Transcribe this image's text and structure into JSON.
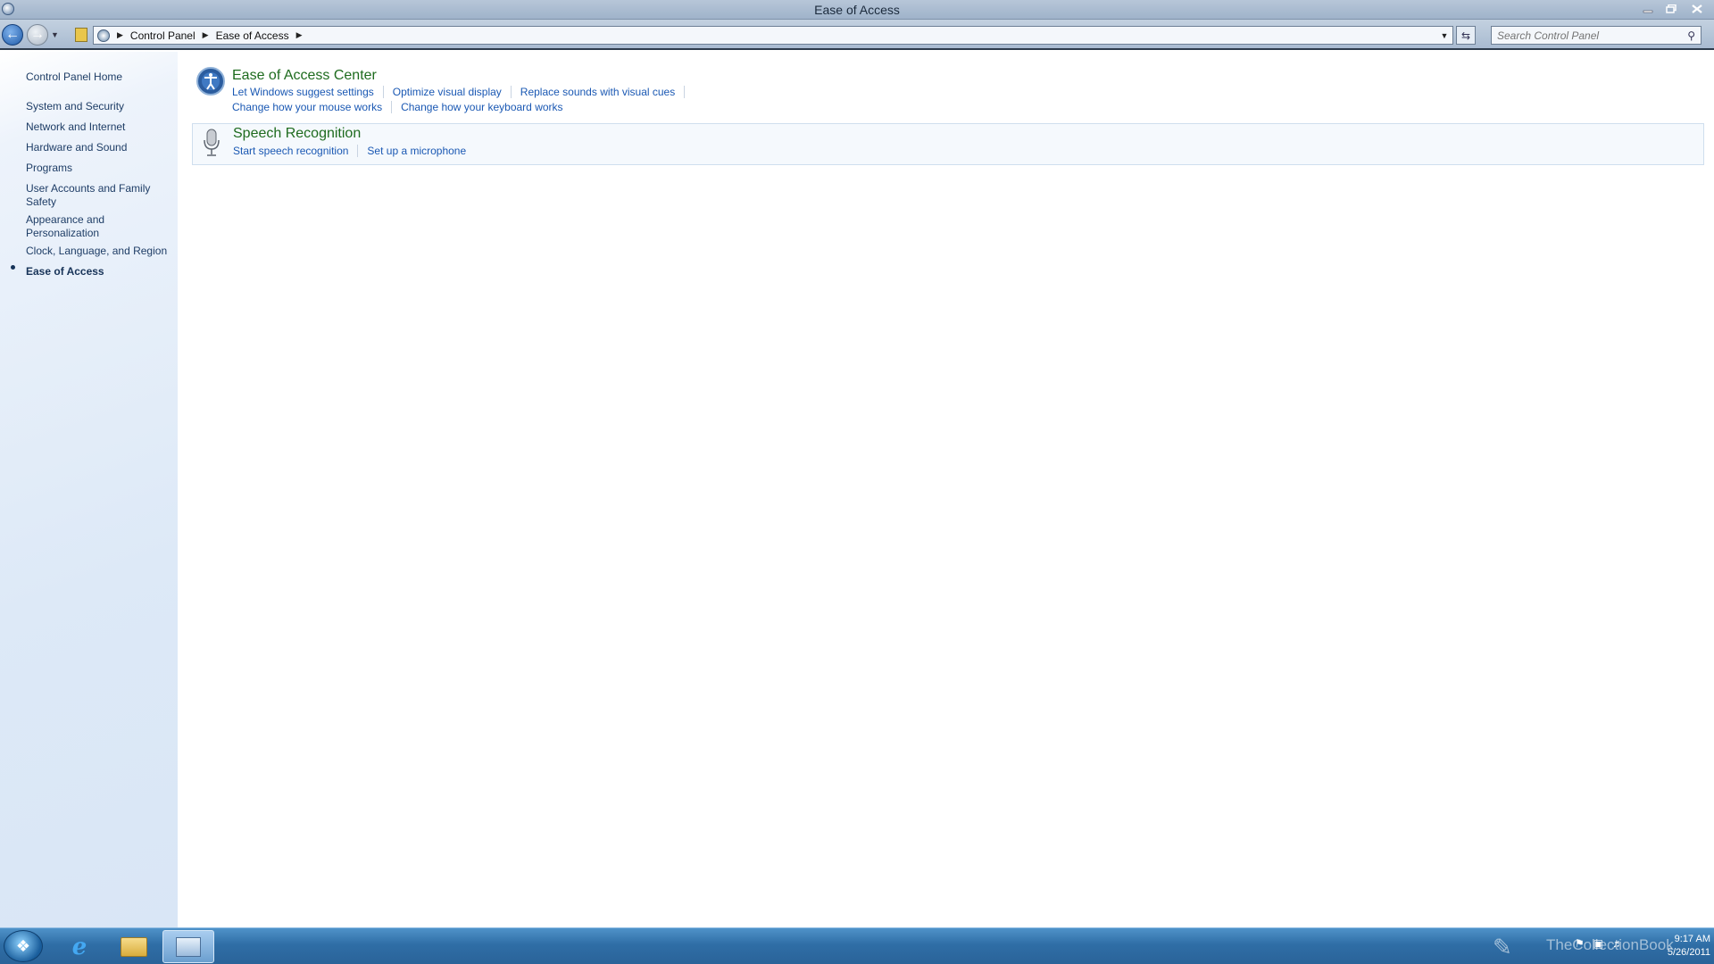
{
  "window": {
    "title": "Ease of Access"
  },
  "address": {
    "crumbs": [
      "Control Panel",
      "Ease of Access"
    ],
    "search_placeholder": "Search Control Panel"
  },
  "sidebar": {
    "items": [
      {
        "label": "Control Panel Home"
      },
      {
        "label": "System and Security"
      },
      {
        "label": "Network and Internet"
      },
      {
        "label": "Hardware and Sound"
      },
      {
        "label": "Programs"
      },
      {
        "label": "User Accounts and Family Safety"
      },
      {
        "label": "Appearance and Personalization"
      },
      {
        "label": "Clock, Language, and Region"
      },
      {
        "label": "Ease of Access",
        "active": true
      }
    ]
  },
  "categories": [
    {
      "title": "Ease of Access Center",
      "icon": "ease-of-access-icon",
      "links_row1": [
        "Let Windows suggest settings",
        "Optimize visual display",
        "Replace sounds with visual cues"
      ],
      "links_row2": [
        "Change how your mouse works",
        "Change how your keyboard works"
      ]
    },
    {
      "title": "Speech Recognition",
      "icon": "microphone-icon",
      "links_row1": [
        "Start speech recognition",
        "Set up a microphone"
      ]
    }
  ],
  "taskbar": {
    "watermark": "TheCollectionBook",
    "clock_time": "9:17 AM",
    "clock_date": "5/26/2011"
  },
  "colors": {
    "link": "#1a58b3",
    "category_title": "#1e6b1e",
    "taskbar": "#2f6ea6"
  }
}
